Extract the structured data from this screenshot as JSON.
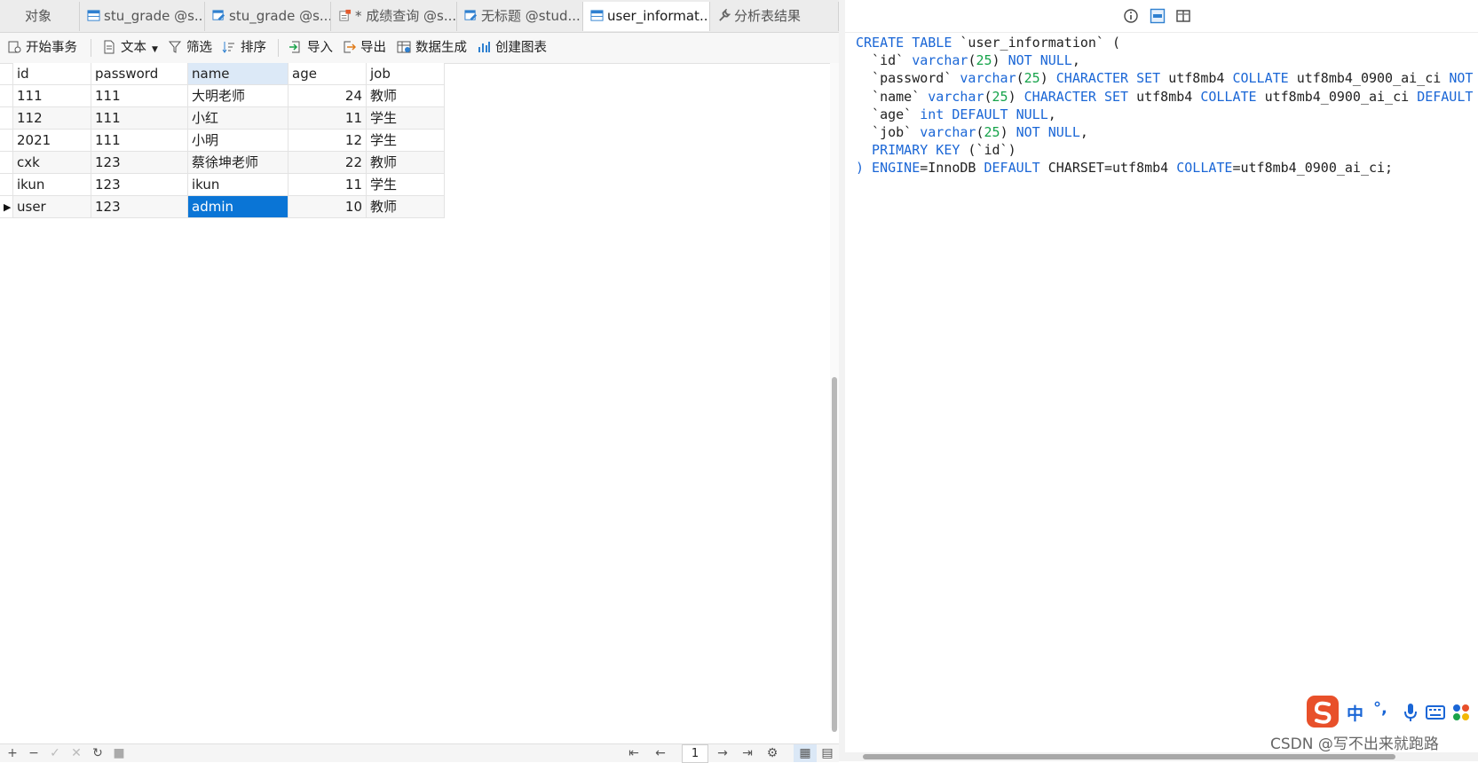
{
  "tabs": [
    {
      "label": "对象",
      "icon": "none"
    },
    {
      "label": "stu_grade @s...",
      "icon": "table-icon"
    },
    {
      "label": "stu_grade @s...",
      "icon": "table-edit-icon"
    },
    {
      "label": "* 成绩查询 @s...",
      "icon": "query-icon"
    },
    {
      "label": "无标题 @stud...",
      "icon": "table-edit-icon"
    },
    {
      "label": "user_informat...",
      "icon": "table-icon",
      "active": true
    },
    {
      "label": "分析表结果",
      "icon": "wrench-icon"
    }
  ],
  "toolbar": {
    "begin_transaction": "开始事务",
    "text": "文本",
    "filter": "筛选",
    "sort": "排序",
    "import": "导入",
    "export": "导出",
    "data_gen": "数据生成",
    "create_chart": "创建图表"
  },
  "grid": {
    "columns": [
      "id",
      "password",
      "name",
      "age",
      "job"
    ],
    "rows": [
      [
        "111",
        "111",
        "大明老师",
        "24",
        "教师"
      ],
      [
        "112",
        "111",
        "小红",
        "11",
        "学生"
      ],
      [
        "2021",
        "111",
        "小明",
        "12",
        "学生"
      ],
      [
        "cxk",
        "123",
        "蔡徐坤老师",
        "22",
        "教师"
      ],
      [
        "ikun",
        "123",
        "ikun",
        "11",
        "学生"
      ],
      [
        "user",
        "123",
        "admin",
        "10",
        "教师"
      ]
    ]
  },
  "status": {
    "page": "1"
  },
  "ddl": {
    "line1_a": "CREATE TABLE",
    "line1_b": " `user_information` (",
    "line2_a": "  `id` ",
    "line2_b": "varchar",
    "line2_c": "(",
    "line2_d": "25",
    "line2_e": ") ",
    "line2_f": "NOT NULL",
    "line2_g": ",",
    "line3_a": "  `password` ",
    "line3_b": "varchar",
    "line3_c": "(",
    "line3_d": "25",
    "line3_e": ") ",
    "line3_f": "CHARACTER SET",
    "line3_g": " utf8mb4 ",
    "line3_h": "COLLATE",
    "line3_i": " utf8mb4_0900_ai_ci ",
    "line3_j": "NOT NULL",
    "line3_k": ",",
    "line4_a": "  `name` ",
    "line4_b": "varchar",
    "line4_c": "(",
    "line4_d": "25",
    "line4_e": ") ",
    "line4_f": "CHARACTER SET",
    "line4_g": " utf8mb4 ",
    "line4_h": "COLLATE",
    "line4_i": " utf8mb4_0900_ai_ci ",
    "line4_j": "DEFAULT NULL",
    "line4_k": ",",
    "line5_a": "  `age` ",
    "line5_b": "int",
    "line5_c": " ",
    "line5_d": "DEFAULT NULL",
    "line5_e": ",",
    "line6_a": "  `job` ",
    "line6_b": "varchar",
    "line6_c": "(",
    "line6_d": "25",
    "line6_e": ") ",
    "line6_f": "NOT NULL",
    "line6_g": ",",
    "line7_a": "  PRIMARY KEY",
    "line7_b": " (`id`)",
    "line8_a": ") ENGINE",
    "line8_b": "=InnoDB ",
    "line8_c": "DEFAULT",
    "line8_d": " CHARSET=utf8mb4 ",
    "line8_e": "COLLATE",
    "line8_f": "=utf8mb4_0900_ai_ci;"
  },
  "ime": {
    "mode": "中",
    "punct": "°,"
  },
  "watermark": "CSDN @写不出来就跑路",
  "colors": {
    "accent": "#0a75d6",
    "keyword": "#1a66d6",
    "number": "#16a34a",
    "brand_ime": "#e8502a"
  }
}
